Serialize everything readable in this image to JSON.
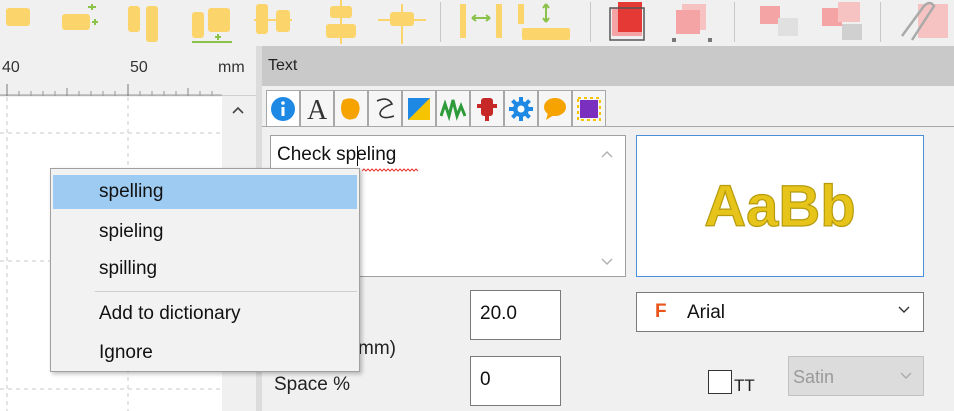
{
  "toolbar": {
    "icons": [
      "align-left-icon",
      "align-right-icon",
      "align-top-icon",
      "align-bottom-icon",
      "align-center-horizontal-icon",
      "align-center-vertical-icon",
      "align-center-icon",
      "same-height-icon",
      "same-width-icon",
      "bring-to-front-icon",
      "send-to-back-icon",
      "group-icon",
      "ungroup-icon",
      "clip-icon"
    ]
  },
  "ruler": {
    "labels": [
      "40",
      "50",
      "mm"
    ],
    "unit": "mm"
  },
  "panel": {
    "title": "Text",
    "tabs": [
      "info-icon",
      "font-icon",
      "fill-icon",
      "outline-icon",
      "shape-icon",
      "waveform-icon",
      "appliqué-icon",
      "settings-icon",
      "comment-icon",
      "selection-icon"
    ]
  },
  "text_editor": {
    "value_part1": "Check s",
    "value_part2": "peling",
    "misspelled_word": "speling"
  },
  "preview": {
    "sample": "AaBb",
    "color": "#e6c419"
  },
  "fields": {
    "height_label": "mm)",
    "height_value": "20.0",
    "space_label": "Space %",
    "space_value": "0",
    "font_name": "Arial",
    "font_icon": "F",
    "tt_label": "TT",
    "stitch_type": "Satin"
  },
  "context_menu": {
    "suggestions": [
      "spelling",
      "spieling",
      "spilling"
    ],
    "actions": [
      "Add to dictionary",
      "Ignore"
    ],
    "highlight_color": "#9ecbf2"
  }
}
